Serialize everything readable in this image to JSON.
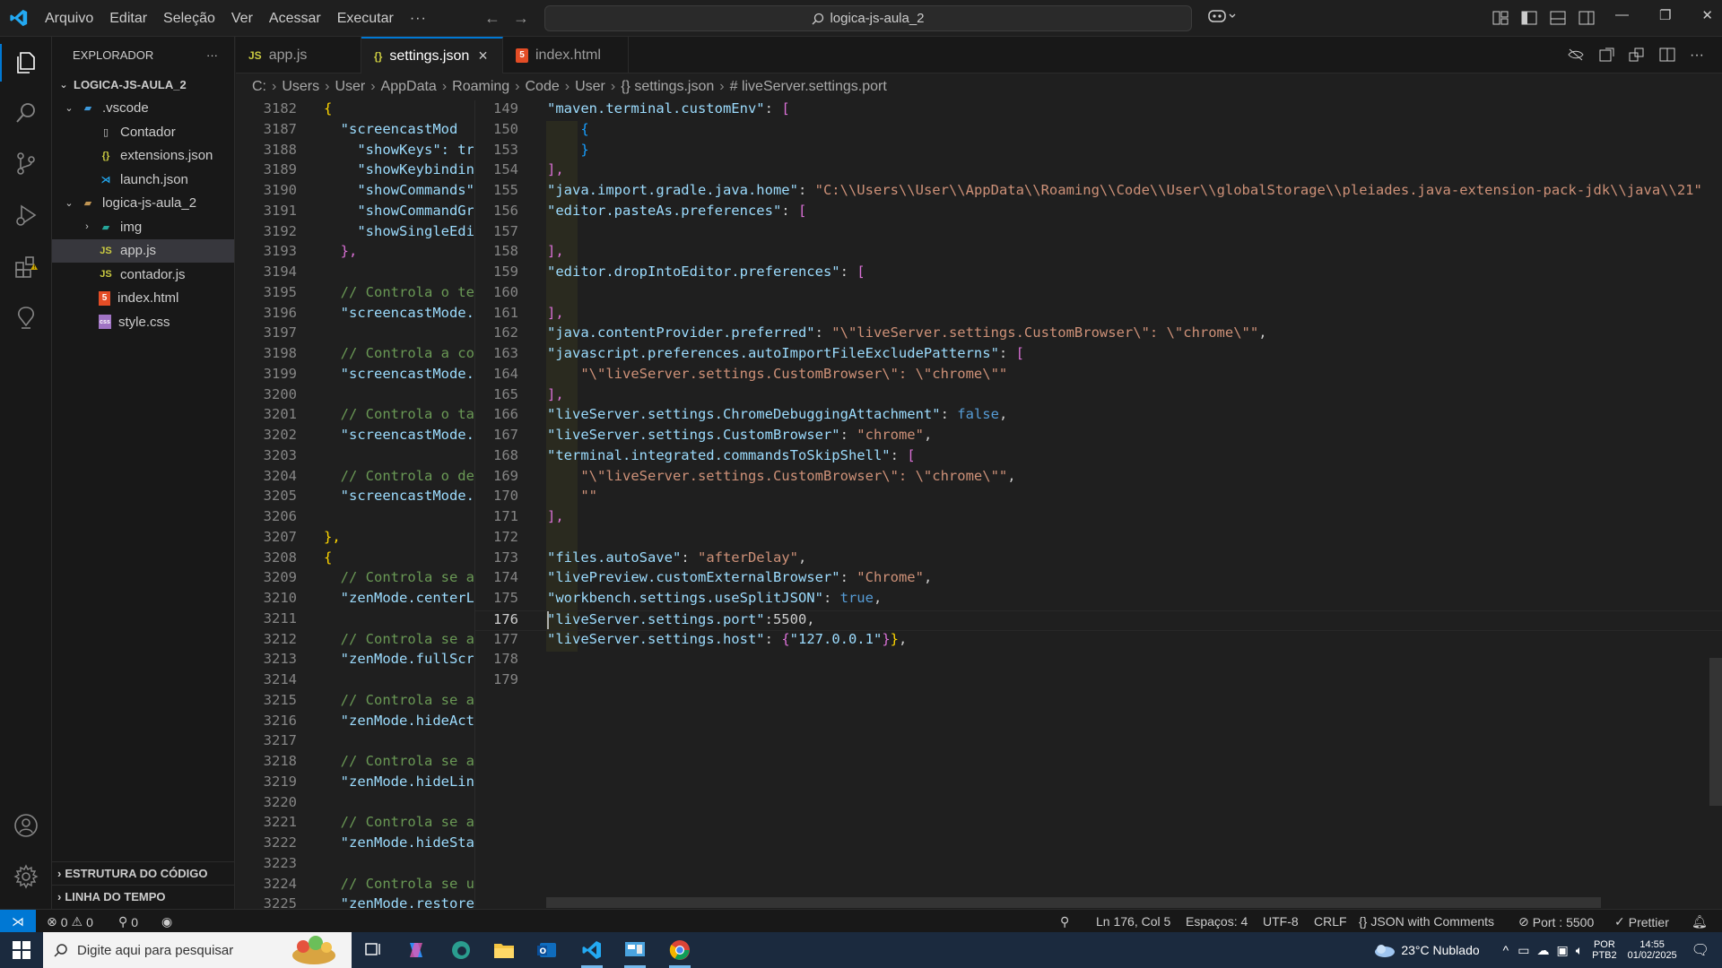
{
  "menu": [
    "Arquivo",
    "Editar",
    "Seleção",
    "Ver",
    "Acessar",
    "Executar",
    "···"
  ],
  "command_center": "logica-js-aula_2",
  "explorer": {
    "title": "EXPLORADOR",
    "more": "···",
    "root": "LOGICA-JS-AULA_2",
    "items": [
      {
        "label": ".vscode",
        "icon": "folder-vscode-icon",
        "depth": 1,
        "chevron": "v"
      },
      {
        "label": "Contador",
        "icon": "file-icon",
        "depth": 2
      },
      {
        "label": "extensions.json",
        "icon": "json-icon",
        "depth": 2
      },
      {
        "label": "launch.json",
        "icon": "vscode-file-icon",
        "depth": 2
      },
      {
        "label": "logica-js-aula_2",
        "icon": "folder-icon",
        "depth": 1,
        "chevron": "v"
      },
      {
        "label": "img",
        "icon": "folder-image-icon",
        "depth": 2,
        "chevron": ">"
      },
      {
        "label": "app.js",
        "icon": "js-icon",
        "depth": 2,
        "selected": true
      },
      {
        "label": "contador.js",
        "icon": "js-icon",
        "depth": 2
      },
      {
        "label": "index.html",
        "icon": "html-icon",
        "depth": 2
      },
      {
        "label": "style.css",
        "icon": "css-icon",
        "depth": 2
      }
    ],
    "outline": "ESTRUTURA DO CÓDIGO",
    "timeline": "LINHA DO TEMPO"
  },
  "tabs": [
    {
      "label": "app.js",
      "icon_text": "JS"
    },
    {
      "label": "settings.json",
      "icon_text": "{}",
      "active": true,
      "close": "×"
    },
    {
      "label": "index.html",
      "icon_text": "5"
    }
  ],
  "breadcrumb": [
    "C:",
    "Users",
    "User",
    "AppData",
    "Roaming",
    "Code",
    "User",
    "{} settings.json",
    "# liveServer.settings.port"
  ],
  "left_lines": [
    {
      "n": "3182",
      "t": [
        [
          "{",
          "b1"
        ]
      ]
    },
    {
      "n": "3187",
      "t": [
        [
          "  \"screencastMod",
          "k"
        ]
      ]
    },
    {
      "n": "3188",
      "t": [
        [
          "    \"showKeys\": tr",
          "k"
        ]
      ]
    },
    {
      "n": "3189",
      "t": [
        [
          "    \"showKeybindin",
          "k"
        ]
      ]
    },
    {
      "n": "3190",
      "t": [
        [
          "    \"showCommands\"",
          "k"
        ]
      ]
    },
    {
      "n": "3191",
      "t": [
        [
          "    \"showCommandGr",
          "k"
        ]
      ]
    },
    {
      "n": "3192",
      "t": [
        [
          "    \"showSingleEdi",
          "k"
        ]
      ]
    },
    {
      "n": "3193",
      "t": [
        [
          "  },",
          "b2"
        ]
      ]
    },
    {
      "n": "3194",
      "t": []
    },
    {
      "n": "3195",
      "t": [
        [
          "  // Controla o te",
          "c"
        ]
      ]
    },
    {
      "n": "3196",
      "t": [
        [
          "  \"screencastMode.",
          "k"
        ]
      ]
    },
    {
      "n": "3197",
      "t": []
    },
    {
      "n": "3198",
      "t": [
        [
          "  // Controla a co",
          "c"
        ]
      ]
    },
    {
      "n": "3199",
      "t": [
        [
          "  \"screencastMode.",
          "k"
        ]
      ]
    },
    {
      "n": "3200",
      "t": []
    },
    {
      "n": "3201",
      "t": [
        [
          "  // Controla o ta",
          "c"
        ]
      ]
    },
    {
      "n": "3202",
      "t": [
        [
          "  \"screencastMode.",
          "k"
        ]
      ]
    },
    {
      "n": "3203",
      "t": []
    },
    {
      "n": "3204",
      "t": [
        [
          "  // Controla o de",
          "c"
        ]
      ]
    },
    {
      "n": "3205",
      "t": [
        [
          "  \"screencastMode.",
          "k"
        ]
      ]
    },
    {
      "n": "3206",
      "t": []
    },
    {
      "n": "3207",
      "t": [
        [
          "},",
          "b1"
        ]
      ]
    },
    {
      "n": "3208",
      "t": [
        [
          "{",
          "b1"
        ]
      ]
    },
    {
      "n": "3209",
      "t": [
        [
          "  // Controla se a",
          "c"
        ]
      ]
    },
    {
      "n": "3210",
      "t": [
        [
          "  \"zenMode.centerL",
          "k"
        ]
      ]
    },
    {
      "n": "3211",
      "t": []
    },
    {
      "n": "3212",
      "t": [
        [
          "  // Controla se a",
          "c"
        ]
      ]
    },
    {
      "n": "3213",
      "t": [
        [
          "  \"zenMode.fullScr",
          "k"
        ]
      ]
    },
    {
      "n": "3214",
      "t": []
    },
    {
      "n": "3215",
      "t": [
        [
          "  // Controla se a",
          "c"
        ]
      ]
    },
    {
      "n": "3216",
      "t": [
        [
          "  \"zenMode.hideAct",
          "k"
        ]
      ]
    },
    {
      "n": "3217",
      "t": []
    },
    {
      "n": "3218",
      "t": [
        [
          "  // Controla se a",
          "c"
        ]
      ]
    },
    {
      "n": "3219",
      "t": [
        [
          "  \"zenMode.hideLin",
          "k"
        ]
      ]
    },
    {
      "n": "3220",
      "t": []
    },
    {
      "n": "3221",
      "t": [
        [
          "  // Controla se a",
          "c"
        ]
      ]
    },
    {
      "n": "3222",
      "t": [
        [
          "  \"zenMode.hideSta",
          "k"
        ]
      ]
    },
    {
      "n": "3223",
      "t": []
    },
    {
      "n": "3224",
      "t": [
        [
          "  // Controla se u",
          "c"
        ]
      ]
    },
    {
      "n": "3225",
      "t": [
        [
          "  \"zenMode.restore",
          "k"
        ]
      ]
    }
  ],
  "right_lines": [
    {
      "n": "149",
      "t": [
        [
          "\"maven.terminal.customEnv\"",
          "k"
        ],
        [
          ": ",
          "p"
        ],
        [
          "[",
          "b2"
        ]
      ]
    },
    {
      "n": "150",
      "t": [
        [
          "    {",
          "b3"
        ]
      ]
    },
    {
      "n": "153",
      "t": [
        [
          "    }",
          "b3"
        ]
      ]
    },
    {
      "n": "154",
      "t": [
        [
          "],",
          "b2"
        ]
      ]
    },
    {
      "n": "155",
      "t": [
        [
          "\"java.import.gradle.java.home\"",
          "k"
        ],
        [
          ": ",
          "p"
        ],
        [
          "\"C:\\\\Users\\\\User\\\\AppData\\\\Roaming\\\\Code\\\\User\\\\globalStorage\\\\pleiades.java-extension-pack-jdk\\\\java\\\\21\"",
          "s"
        ]
      ]
    },
    {
      "n": "156",
      "t": [
        [
          "\"editor.pasteAs.preferences\"",
          "k"
        ],
        [
          ": ",
          "p"
        ],
        [
          "[",
          "b2"
        ]
      ]
    },
    {
      "n": "157",
      "t": []
    },
    {
      "n": "158",
      "t": [
        [
          "],",
          "b2"
        ]
      ]
    },
    {
      "n": "159",
      "t": [
        [
          "\"editor.dropIntoEditor.preferences\"",
          "k"
        ],
        [
          ": ",
          "p"
        ],
        [
          "[",
          "b2"
        ]
      ]
    },
    {
      "n": "160",
      "t": []
    },
    {
      "n": "161",
      "t": [
        [
          "],",
          "b2"
        ]
      ]
    },
    {
      "n": "162",
      "t": [
        [
          "\"java.contentProvider.preferred\"",
          "k"
        ],
        [
          ": ",
          "p"
        ],
        [
          "\"\\\"liveServer.settings.CustomBrowser\\\": \\\"chrome\\\"\"",
          "s"
        ],
        [
          ",",
          "p"
        ]
      ]
    },
    {
      "n": "163",
      "t": [
        [
          "\"javascript.preferences.autoImportFileExcludePatterns\"",
          "k"
        ],
        [
          ": ",
          "p"
        ],
        [
          "[",
          "b2"
        ]
      ]
    },
    {
      "n": "164",
      "t": [
        [
          "    \"\\\"liveServer.settings.CustomBrowser\\\": \\\"chrome\\\"\"",
          "s"
        ]
      ]
    },
    {
      "n": "165",
      "t": [
        [
          "],",
          "b2"
        ]
      ]
    },
    {
      "n": "166",
      "t": [
        [
          "\"liveServer.settings.ChromeDebuggingAttachment\"",
          "k"
        ],
        [
          ": ",
          "p"
        ],
        [
          "false",
          "kw"
        ],
        [
          ",",
          "p"
        ]
      ]
    },
    {
      "n": "167",
      "t": [
        [
          "\"liveServer.settings.CustomBrowser\"",
          "k"
        ],
        [
          ": ",
          "p"
        ],
        [
          "\"chrome\"",
          "s"
        ],
        [
          ",",
          "p"
        ]
      ]
    },
    {
      "n": "168",
      "t": [
        [
          "\"terminal.integrated.commandsToSkipShell\"",
          "k"
        ],
        [
          ": ",
          "p"
        ],
        [
          "[",
          "b2"
        ]
      ]
    },
    {
      "n": "169",
      "t": [
        [
          "    \"\\\"liveServer.settings.CustomBrowser\\\": \\\"chrome\\\"\"",
          "s"
        ],
        [
          ",",
          "p"
        ]
      ]
    },
    {
      "n": "170",
      "t": [
        [
          "    \"\"",
          "s"
        ]
      ]
    },
    {
      "n": "171",
      "t": [
        [
          "],",
          "b2"
        ]
      ]
    },
    {
      "n": "172",
      "t": []
    },
    {
      "n": "173",
      "t": [
        [
          "\"files.autoSave\"",
          "k"
        ],
        [
          ": ",
          "p"
        ],
        [
          "\"afterDelay\"",
          "s"
        ],
        [
          ",",
          "p"
        ]
      ]
    },
    {
      "n": "174",
      "t": [
        [
          "\"livePreview.customExternalBrowser\"",
          "k"
        ],
        [
          ": ",
          "p"
        ],
        [
          "\"Chrome\"",
          "s"
        ],
        [
          ",",
          "p"
        ]
      ]
    },
    {
      "n": "175",
      "t": [
        [
          "\"workbench.settings.useSplitJSON\"",
          "k"
        ],
        [
          ": ",
          "p"
        ],
        [
          "true",
          "kw"
        ],
        [
          ",",
          "p"
        ]
      ]
    },
    {
      "n": "176",
      "t": [
        [
          "\"liveServer.settings.port\"",
          "k"
        ],
        [
          ":5500,",
          "p"
        ]
      ],
      "current": true
    },
    {
      "n": "177",
      "t": [
        [
          "\"liveServer.settings.host\"",
          "k"
        ],
        [
          ": ",
          "p"
        ],
        [
          "{",
          "b2"
        ],
        [
          "\"127.0.0.1\"",
          "k"
        ],
        [
          "}",
          "b2"
        ],
        [
          "}",
          "b1"
        ],
        [
          ",",
          "p"
        ]
      ]
    },
    {
      "n": "178",
      "t": []
    },
    {
      "n": "179",
      "t": []
    }
  ],
  "status": {
    "errors": "0",
    "warnings": "0",
    "ports": "0",
    "position": "Ln 176, Col 5",
    "spaces": "Espaços: 4",
    "encoding": "UTF-8",
    "eol": "CRLF",
    "language": "JSON with Comments",
    "port": "Port : 5500",
    "prettier": "Prettier"
  },
  "taskbar": {
    "search_placeholder": "Digite aqui para pesquisar",
    "weather": "23°C  Nublado",
    "lang": "POR",
    "layout": "PTB2",
    "time": "14:55",
    "date": "01/02/2025"
  },
  "colors": {
    "accent": "#0078d4",
    "editor_bg": "#1f1f1f",
    "sidebar_bg": "#181818",
    "json_key": "#9cdcfe",
    "json_string": "#ce9178"
  }
}
